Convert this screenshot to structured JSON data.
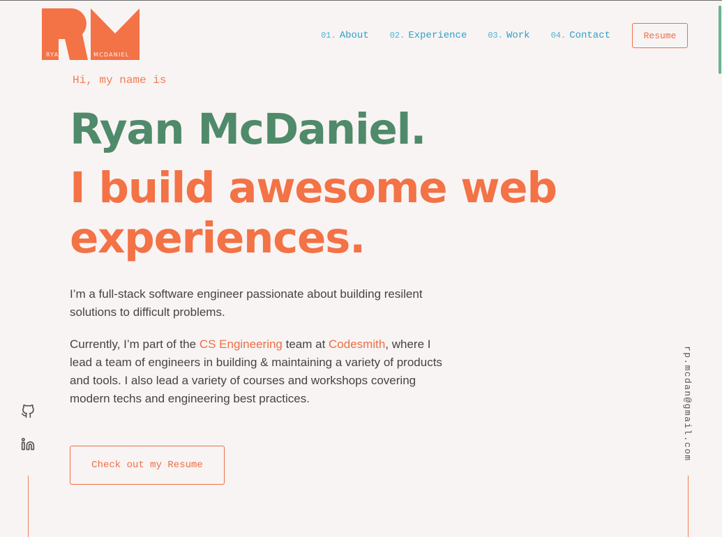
{
  "logo": {
    "first_name": "RYAN",
    "last_name": "MCDANIEL",
    "color": "#f37246"
  },
  "nav": {
    "items": [
      {
        "num": "01.",
        "label": "About"
      },
      {
        "num": "02.",
        "label": "Experience"
      },
      {
        "num": "03.",
        "label": "Work"
      },
      {
        "num": "04.",
        "label": "Contact"
      }
    ],
    "resume_label": "Resume"
  },
  "hero": {
    "greeting": "Hi, my name is",
    "name": "Ryan McDaniel.",
    "tagline_line1": "I build awesome web",
    "tagline_line2": "experiences.",
    "intro_1": "I’m a full-stack software engineer passionate about building resilent solutions to difficult problems.",
    "intro_2_pre": "Currently, I’m part of the ",
    "intro_2_link1": "CS Engineering",
    "intro_2_mid": " team at ",
    "intro_2_link2": "Codesmith",
    "intro_2_post": ", where I lead a team of engineers in building & maintaining a variety of products and tools. I also lead a variety of courses and workshops covering modern techs and engineering best practices.",
    "cta_label": "Check out my Resume"
  },
  "social": {
    "icons": [
      "github-icon",
      "linkedin-icon"
    ]
  },
  "email": "rp.mcdan@gmail.com",
  "colors": {
    "background": "#f8f4f3",
    "accent_orange": "#f37246",
    "name_green": "#4f8a6a",
    "nav_blue": "#2f9fc9",
    "scroll_green": "#6bb38c"
  }
}
